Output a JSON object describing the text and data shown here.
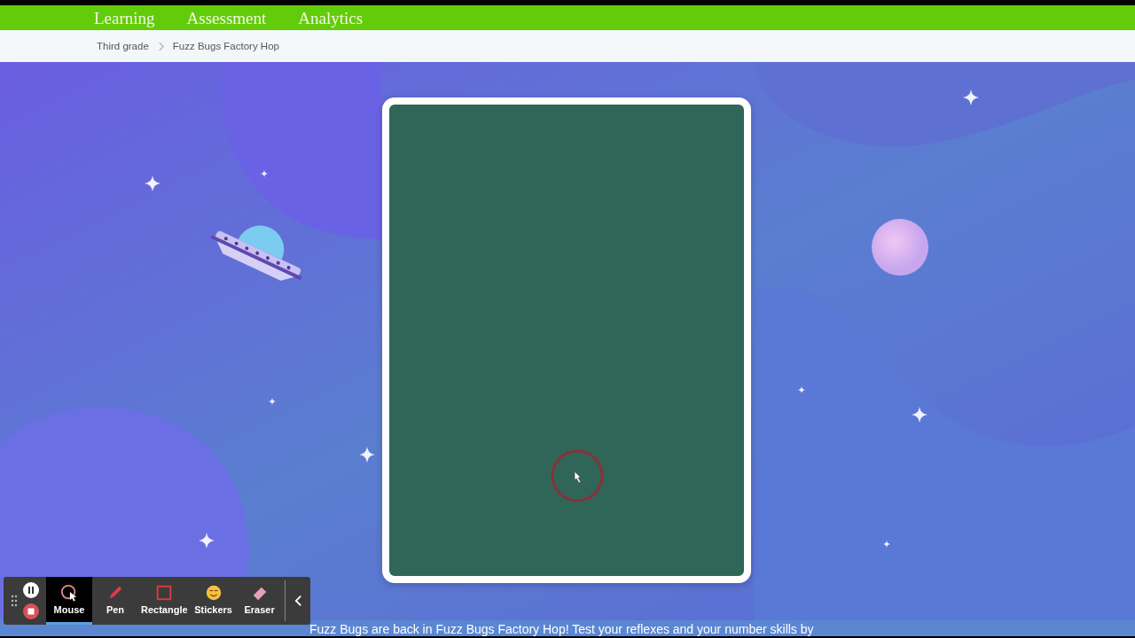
{
  "nav": {
    "items": [
      "Learning",
      "Assessment",
      "Analytics"
    ]
  },
  "breadcrumb": [
    "Third grade",
    "Fuzz Bugs Factory Hop"
  ],
  "description": "Fuzz Bugs are back in Fuzz Bugs Factory Hop! Test your reflexes and your number skills by",
  "recorder": {
    "tools": [
      {
        "label": "Mouse",
        "kind": "mouse",
        "selected": true
      },
      {
        "label": "Pen",
        "kind": "pen",
        "selected": false
      },
      {
        "label": "Rectangle",
        "kind": "rectangle",
        "selected": false
      },
      {
        "label": "Stickers",
        "kind": "stickers",
        "selected": false
      },
      {
        "label": "Eraser",
        "kind": "eraser",
        "selected": false
      }
    ]
  }
}
